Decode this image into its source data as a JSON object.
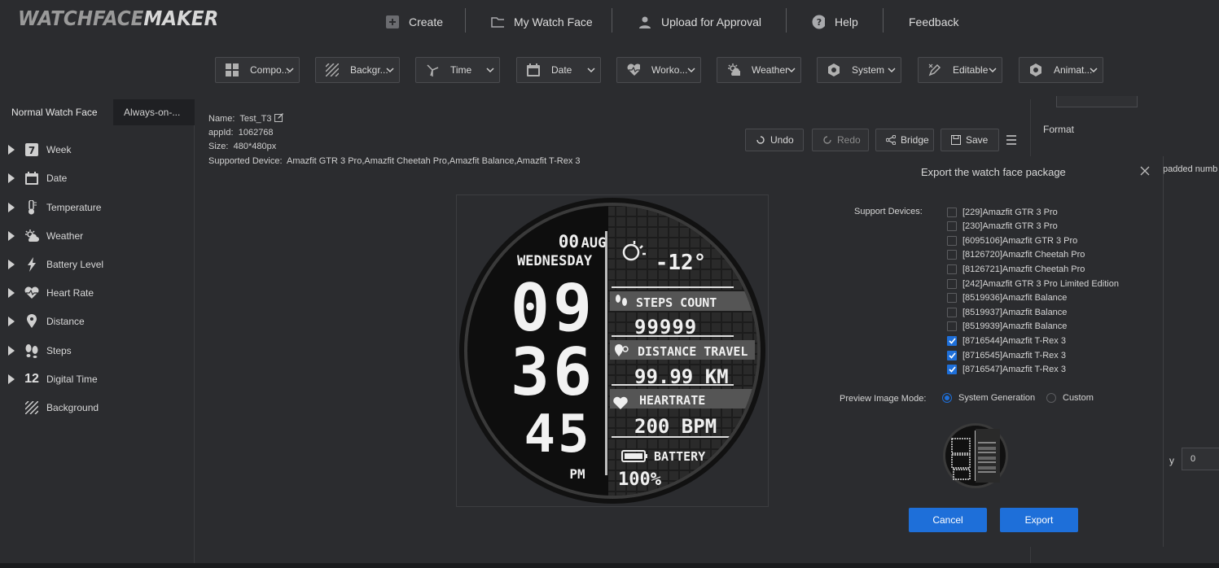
{
  "app": {
    "logo_a": "WATCHFACE",
    "logo_b": "MAKER"
  },
  "nav": {
    "create": "Create",
    "my_watch_face": "My Watch Face",
    "upload": "Upload for Approval",
    "help": "Help",
    "feedback": "Feedback"
  },
  "toolbar": [
    "Compo...",
    "Backgr...",
    "Time",
    "Date",
    "Worko...",
    "Weather",
    "System",
    "Editable",
    "Animat..."
  ],
  "left": {
    "tab_active": "Normal Watch Face",
    "tab_inactive": "Always-on-...",
    "items": [
      "Week",
      "Date",
      "Temperature",
      "Weather",
      "Battery Level",
      "Heart Rate",
      "Distance",
      "Steps",
      "Digital Time",
      "Background"
    ]
  },
  "info": {
    "name_label": "Name:",
    "name_value": "Test_T3",
    "appid_label": "appId:",
    "appid_value": "1062768",
    "size_label": "Size:",
    "size_value": "480*480px",
    "devices_label": "Supported Device:",
    "devices_value": "Amazfit GTR 3 Pro,Amazfit Cheetah Pro,Amazfit Balance,Amazfit T-Rex 3"
  },
  "actions": {
    "undo": "Undo",
    "redo": "Redo",
    "bridge": "Bridge",
    "save": "Save"
  },
  "watch": {
    "day": "00",
    "month": "AUG",
    "weekday": "WEDNESDAY",
    "hour": "09",
    "minute_a": "36",
    "minute_b": "45",
    "ampm": "PM",
    "temp": "-12°",
    "steps_label": "STEPS COUNT",
    "steps_value": "99999",
    "dist_label": "DISTANCE TRAVEL",
    "dist_value": "99.99 KM",
    "hr_label": "HEARTRATE",
    "hr_value": "200 BPM",
    "bat_label": "BATTERY",
    "bat_value": "100%"
  },
  "right": {
    "format": "Format",
    "padded": "padded numb",
    "y_label": "y",
    "y_value": "0"
  },
  "dialog": {
    "title": "Export the watch face package",
    "support_label": "Support Devices:",
    "devices": [
      {
        "label": "[229]Amazfit GTR 3 Pro",
        "checked": false
      },
      {
        "label": "[230]Amazfit GTR 3 Pro",
        "checked": false
      },
      {
        "label": "[6095106]Amazfit GTR 3 Pro",
        "checked": false
      },
      {
        "label": "[8126720]Amazfit Cheetah Pro",
        "checked": false
      },
      {
        "label": "[8126721]Amazfit Cheetah Pro",
        "checked": false
      },
      {
        "label": "[242]Amazfit GTR 3 Pro Limited Edition",
        "checked": false
      },
      {
        "label": "[8519936]Amazfit Balance",
        "checked": false
      },
      {
        "label": "[8519937]Amazfit Balance",
        "checked": false
      },
      {
        "label": "[8519939]Amazfit Balance",
        "checked": false
      },
      {
        "label": "[8716544]Amazfit T-Rex 3",
        "checked": true
      },
      {
        "label": "[8716545]Amazfit T-Rex 3",
        "checked": true
      },
      {
        "label": "[8716547]Amazfit T-Rex 3",
        "checked": true
      }
    ],
    "preview_label": "Preview Image Mode:",
    "opt_system": "System Generation",
    "opt_custom": "Custom",
    "cancel": "Cancel",
    "export": "Export"
  },
  "colors": {
    "accent": "#1e6fd9",
    "bg": "#2b2c2f"
  }
}
